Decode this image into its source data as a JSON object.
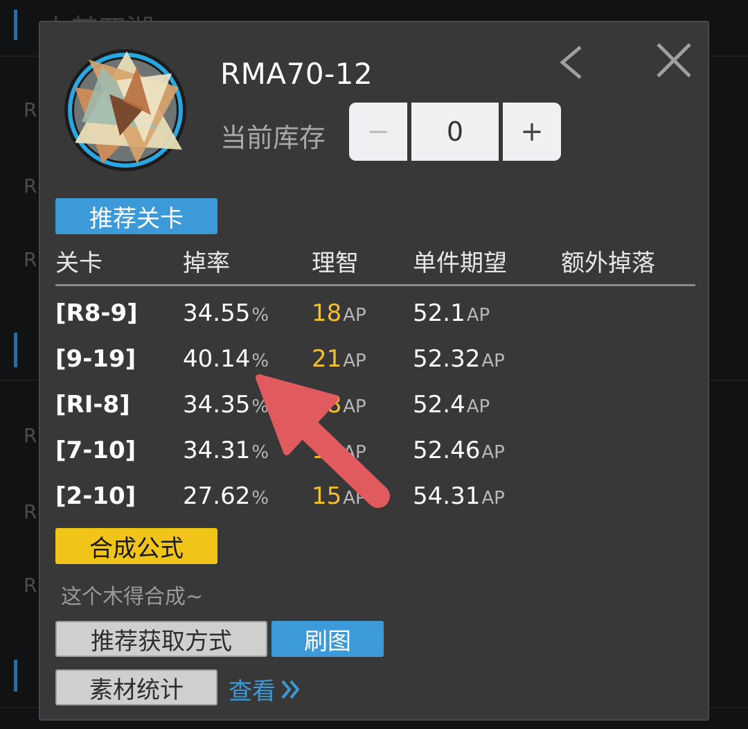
{
  "item": {
    "name": "RMA70-12",
    "stock_label": "当前库存",
    "stock_value": "0",
    "minus_label": "−",
    "plus_label": "+"
  },
  "sections": {
    "recommended_stages": "推荐关卡",
    "synthesis": "合成公式",
    "synthesis_hint": "这个木得合成~",
    "recommended_acquire": "推荐获取方式",
    "farm": "刷图",
    "material_stats": "素材统计",
    "view": "查看"
  },
  "table": {
    "headers": [
      "关卡",
      "掉率",
      "理智",
      "单件期望",
      "额外掉落"
    ],
    "rows": [
      {
        "stage": "[R8-9]",
        "rate": "34.55",
        "ap": "18",
        "expect": "52.1"
      },
      {
        "stage": "[9-19]",
        "rate": "40.14",
        "ap": "21",
        "expect": "52.32"
      },
      {
        "stage": "[RI-8]",
        "rate": "34.35",
        "ap": "18",
        "expect": "52.4"
      },
      {
        "stage": "[7-10]",
        "rate": "34.31",
        "ap": "18",
        "expect": "52.46"
      },
      {
        "stage": "[2-10]",
        "rate": "27.62",
        "ap": "15",
        "expect": "54.31"
      }
    ],
    "percent_unit": "%",
    "ap_unit": "AP"
  },
  "background": {
    "heading_fragment": "上其四湖",
    "row_fragment": "R"
  },
  "colors": {
    "accent_blue": "#3d9ad8",
    "accent_yellow": "#f0c419",
    "ap_yellow": "#f2c12e",
    "annotation_arrow": "#e05a5e"
  },
  "icons": [
    "back-chevron-icon",
    "close-x-icon",
    "item-emblem-icon",
    "double-chevron-right-icon",
    "annotation-arrow"
  ]
}
